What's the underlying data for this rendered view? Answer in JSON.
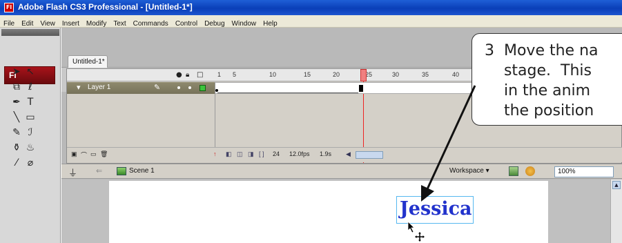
{
  "window": {
    "title": "Adobe Flash CS3 Professional - [Untitled-1*]",
    "app_icon": "Fl"
  },
  "menu": {
    "items": [
      "File",
      "Edit",
      "View",
      "Insert",
      "Modify",
      "Text",
      "Commands",
      "Control",
      "Debug",
      "Window",
      "Help"
    ]
  },
  "tools": {
    "logo": "Fl",
    "items": [
      {
        "name": "selection-tool-icon",
        "glyph": "➤"
      },
      {
        "name": "subselection-tool-icon",
        "glyph": "↖"
      },
      {
        "name": "free-transform-tool-icon",
        "glyph": "⧉"
      },
      {
        "name": "lasso-tool-icon",
        "glyph": "ℓ"
      },
      {
        "name": "pen-tool-icon",
        "glyph": "✒"
      },
      {
        "name": "text-tool-icon",
        "glyph": "T"
      },
      {
        "name": "line-tool-icon",
        "glyph": "╲"
      },
      {
        "name": "rectangle-tool-icon",
        "glyph": "▭"
      },
      {
        "name": "pencil-tool-icon",
        "glyph": "✎"
      },
      {
        "name": "brush-tool-icon",
        "glyph": "ℐ"
      },
      {
        "name": "ink-bottle-tool-icon",
        "glyph": "⚱"
      },
      {
        "name": "paint-bucket-tool-icon",
        "glyph": "♨"
      },
      {
        "name": "eyedropper-tool-icon",
        "glyph": "⁄"
      },
      {
        "name": "eraser-tool-icon",
        "glyph": "⌀"
      }
    ]
  },
  "document": {
    "tab_label": "Untitled-1*"
  },
  "timeline": {
    "frame_numbers": [
      "1",
      "5",
      "10",
      "15",
      "20",
      "25",
      "30",
      "35",
      "40"
    ],
    "layer_name": "Layer 1",
    "footer": {
      "frame_rate_frame": "24",
      "fps": "12.0fps",
      "time": "1.9s"
    }
  },
  "editbar": {
    "scene_label": "Scene 1",
    "workspace_label": "Workspace ▾",
    "zoom": "100%"
  },
  "stage": {
    "text_object": "Jessica"
  },
  "callout": {
    "step_text": "3  Move the na\n    stage.  This \n    in the anim\n    the position"
  },
  "colors": {
    "accent_blue_text": "#2233cc",
    "playhead": "#e22222",
    "layer_swatch": "#3cc43c"
  }
}
